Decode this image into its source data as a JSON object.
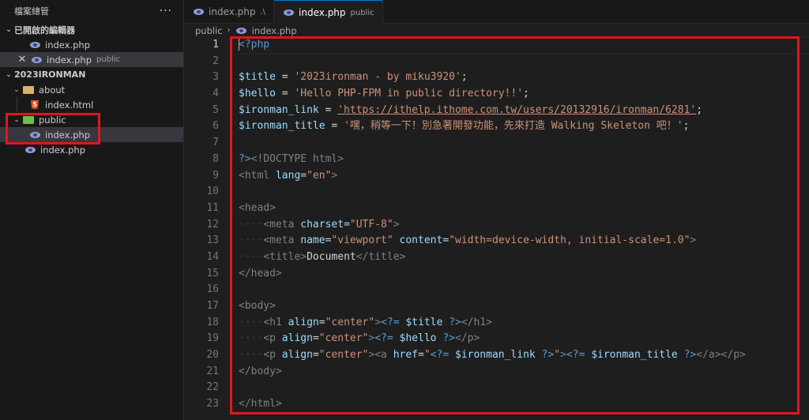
{
  "explorer": {
    "title": "檔案總管",
    "more_label": "···",
    "open_editors_label": "已開啟的編輯器",
    "open_editors": [
      {
        "name": "index.php",
        "desc": ""
      },
      {
        "name": "index.php",
        "desc": "public"
      }
    ],
    "project_label": "2023IRONMAN",
    "tree": {
      "about": "about",
      "index_html": "index.html",
      "public": "public",
      "public_index": "index.php",
      "root_index": "index.php"
    }
  },
  "tabs": [
    {
      "name": "index.php",
      "desc": ".\\",
      "icon": "php-icon"
    },
    {
      "name": "index.php",
      "desc": "public",
      "icon": "php-icon"
    }
  ],
  "breadcrumb": {
    "folder": "public",
    "sep": "›",
    "file": "index.php"
  },
  "editor": {
    "line_numbers": [
      "1",
      "2",
      "3",
      "4",
      "5",
      "6",
      "7",
      "8",
      "9",
      "10",
      "11",
      "12",
      "13",
      "14",
      "15",
      "16",
      "17",
      "18",
      "19",
      "20",
      "21",
      "22",
      "23"
    ],
    "code": {
      "l1": "<?php",
      "l3a": "$title",
      "l3b": " = ",
      "l3c": "'2023ironman - by miku3920'",
      "l3d": ";",
      "l4a": "$hello",
      "l4b": " = ",
      "l4c": "'Hello PHP-FPM in public directory!!'",
      "l4d": ";",
      "l5a": "$ironman_link",
      "l5b": " = ",
      "l5c": "'https://ithelp.ithome.com.tw/users/20132916/ironman/6281'",
      "l5d": ";",
      "l6a": "$ironman_title",
      "l6b": " = ",
      "l6c": "'嘿，稍等一下！別急著開發功能，先來打造 Walking Skeleton 吧！'",
      "l6d": ";",
      "l8a": "?>",
      "l8b": "<!DOCTYPE html>",
      "l9a": "<html",
      "l9b": " lang",
      "l9c": "=",
      "l9d": "\"en\"",
      "l9e": ">",
      "l11": "<head>",
      "l12a": "<meta",
      "l12b": " charset",
      "l12c": "=",
      "l12d": "\"UTF-8\"",
      "l12e": ">",
      "l13a": "<meta",
      "l13b": " name",
      "l13c": "=",
      "l13d": "\"viewport\"",
      "l13e": " content",
      "l13f": "=",
      "l13g": "\"width=device-width, initial-scale=1.0\"",
      "l13h": ">",
      "l14a": "<title>",
      "l14b": "Document",
      "l14c": "</title>",
      "l15": "</head>",
      "l17": "<body>",
      "l18a": "<h1",
      "l18b": " align",
      "l18c": "=",
      "l18d": "\"center\"",
      "l18e": ">",
      "l18f": "<?= ",
      "l18g": "$title",
      "l18h": " ?>",
      "l18i": "</h1>",
      "l19a": "<p",
      "l19b": " align",
      "l19c": "=",
      "l19d": "\"center\"",
      "l19e": ">",
      "l19f": "<?= ",
      "l19g": "$hello",
      "l19h": " ?>",
      "l19i": "</p>",
      "l20a": "<p",
      "l20b": " align",
      "l20c": "=",
      "l20d": "\"center\"",
      "l20e": "><a",
      "l20f": " href",
      "l20g": "=",
      "l20h": "\"",
      "l20i": "<?= ",
      "l20j": "$ironman_link",
      "l20k": " ?>",
      "l20l": "\"",
      "l20m": ">",
      "l20n": "<?= ",
      "l20o": "$ironman_title",
      "l20p": " ?>",
      "l20q": "</a></p>",
      "l21": "</body>",
      "l23": "</html>"
    }
  },
  "colors": {
    "highlight_box": "#e0161e",
    "accent": "#0078d4"
  }
}
